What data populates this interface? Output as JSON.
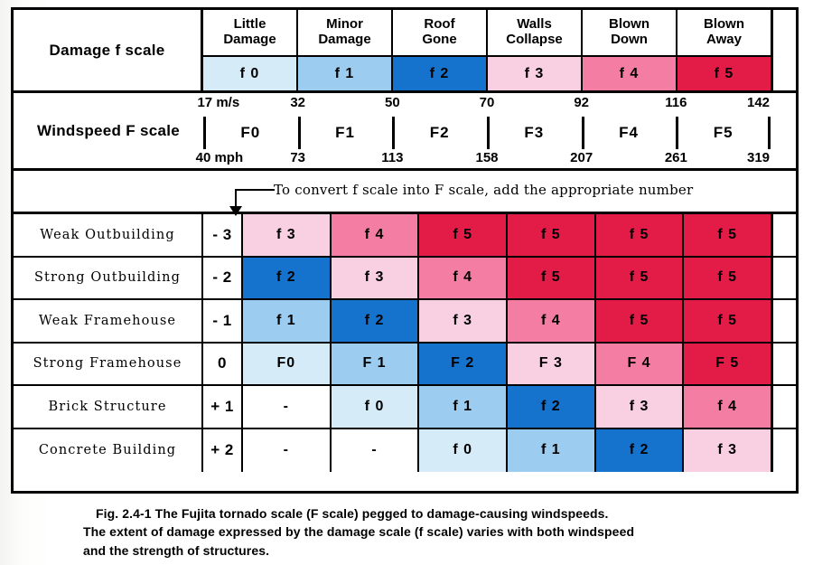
{
  "figure": {
    "caption_lines": [
      "Fig. 2.4-1  The Fujita tornado scale (F scale) pegged to damage-causing windspeeds.",
      "The extent of damage expressed by the damage scale (f scale) varies with both windspeed",
      "and the strength of structures."
    ]
  },
  "damage_band": {
    "title": "Damage  f scale",
    "columns": [
      {
        "name_line1": "Little",
        "name_line2": "Damage",
        "code": "f 0",
        "color_key": "f0"
      },
      {
        "name_line1": "Minor",
        "name_line2": "Damage",
        "code": "f 1",
        "color_key": "f1"
      },
      {
        "name_line1": "Roof",
        "name_line2": "Gone",
        "code": "f 2",
        "color_key": "f2"
      },
      {
        "name_line1": "Walls",
        "name_line2": "Collapse",
        "code": "f 3",
        "color_key": "f3"
      },
      {
        "name_line1": "Blown",
        "name_line2": "Down",
        "code": "f 4",
        "color_key": "f4"
      },
      {
        "name_line1": "Blown",
        "name_line2": "Away",
        "code": "f 5",
        "color_key": "f5"
      }
    ]
  },
  "wind_band": {
    "title": "Windspeed  F scale",
    "segments": [
      "F0",
      "F1",
      "F2",
      "F3",
      "F4",
      "F5"
    ],
    "ticks_ms": [
      "17 m/s",
      "32",
      "50",
      "70",
      "92",
      "116",
      "142"
    ],
    "ticks_mph": [
      "40 mph",
      "73",
      "113",
      "158",
      "207",
      "261",
      "319"
    ]
  },
  "note_band": {
    "text": "To convert f scale into F scale, add the appropriate number"
  },
  "matrix": {
    "rows": [
      {
        "label": "Weak Outbuilding",
        "offset": "- 3",
        "cells": [
          {
            "text": "f 3",
            "color_key": "f3"
          },
          {
            "text": "f 4",
            "color_key": "f4"
          },
          {
            "text": "f 5",
            "color_key": "f5"
          },
          {
            "text": "f 5",
            "color_key": "f5"
          },
          {
            "text": "f 5",
            "color_key": "f5"
          },
          {
            "text": "f 5",
            "color_key": "f5"
          }
        ]
      },
      {
        "label": "Strong Outbuilding",
        "offset": "- 2",
        "cells": [
          {
            "text": "f 2",
            "color_key": "f2"
          },
          {
            "text": "f 3",
            "color_key": "f3"
          },
          {
            "text": "f 4",
            "color_key": "f4"
          },
          {
            "text": "f 5",
            "color_key": "f5"
          },
          {
            "text": "f 5",
            "color_key": "f5"
          },
          {
            "text": "f 5",
            "color_key": "f5"
          }
        ]
      },
      {
        "label": "Weak Framehouse",
        "offset": "- 1",
        "cells": [
          {
            "text": "f 1",
            "color_key": "f1"
          },
          {
            "text": "f 2",
            "color_key": "f2"
          },
          {
            "text": "f 3",
            "color_key": "f3"
          },
          {
            "text": "f 4",
            "color_key": "f4"
          },
          {
            "text": "f 5",
            "color_key": "f5"
          },
          {
            "text": "f 5",
            "color_key": "f5"
          }
        ]
      },
      {
        "label": "Strong Framehouse",
        "offset": "0",
        "cells": [
          {
            "text": "F0",
            "color_key": "f0"
          },
          {
            "text": "F 1",
            "color_key": "f1"
          },
          {
            "text": "F 2",
            "color_key": "f2"
          },
          {
            "text": "F 3",
            "color_key": "f3"
          },
          {
            "text": "F 4",
            "color_key": "f4"
          },
          {
            "text": "F 5",
            "color_key": "f5"
          }
        ]
      },
      {
        "label": "Brick Structure",
        "offset": "+ 1",
        "cells": [
          {
            "text": "-",
            "color_key": "none"
          },
          {
            "text": "f 0",
            "color_key": "f0"
          },
          {
            "text": "f 1",
            "color_key": "f1"
          },
          {
            "text": "f 2",
            "color_key": "f2"
          },
          {
            "text": "f 3",
            "color_key": "f3"
          },
          {
            "text": "f 4",
            "color_key": "f4"
          }
        ]
      },
      {
        "label": "Concrete Building",
        "offset": "+ 2",
        "cells": [
          {
            "text": "-",
            "color_key": "none"
          },
          {
            "text": "-",
            "color_key": "none"
          },
          {
            "text": "f 0",
            "color_key": "f0"
          },
          {
            "text": "f 1",
            "color_key": "f1"
          },
          {
            "text": "f 2",
            "color_key": "f2"
          },
          {
            "text": "f 3",
            "color_key": "f3"
          }
        ]
      }
    ]
  },
  "colors": {
    "f0": "#d5ebf8",
    "f1": "#9ccdf0",
    "f2": "#1573cd",
    "f3": "#f9cfe2",
    "f4": "#f47da4",
    "f5": "#e31c47",
    "none": "#ffffff",
    "ink": "#000000"
  }
}
